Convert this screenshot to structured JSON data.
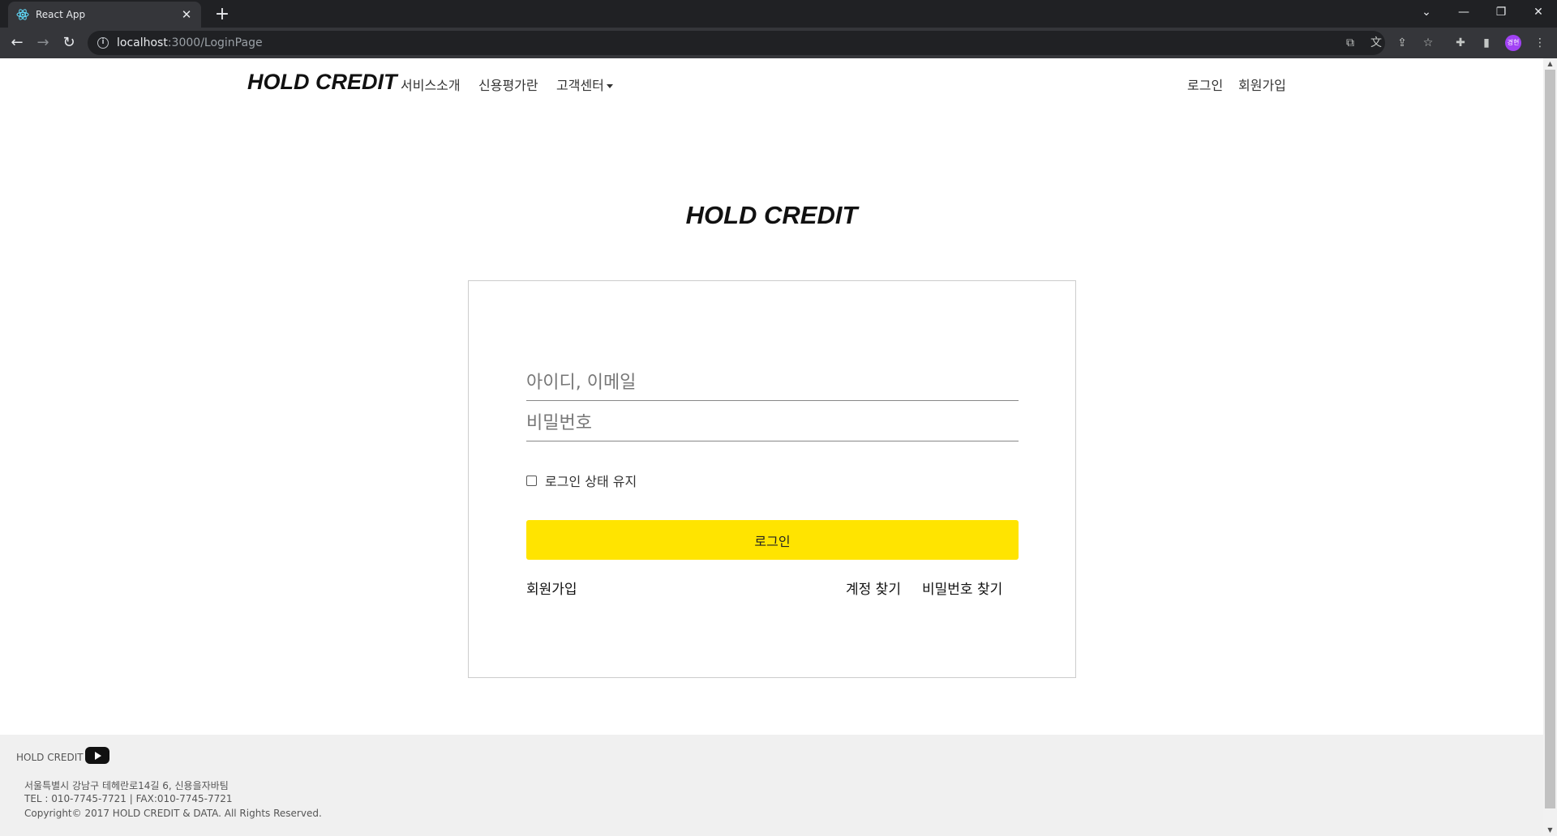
{
  "browser": {
    "tab_title": "React App",
    "url_host": "localhost",
    "url_path": ":3000/LoginPage",
    "profile_initials": "경현"
  },
  "nav": {
    "brand": "HOLD CREDIT",
    "links": [
      "서비스소개",
      "신용평가란",
      "고객센터"
    ],
    "login": "로그인",
    "signup": "회원가입"
  },
  "hero": {
    "title": "HOLD CREDIT"
  },
  "login_form": {
    "id_placeholder": "아이디, 이메일",
    "pw_placeholder": "비밀번호",
    "keep_logged_in": "로그인 상태 유지",
    "keep_checked": false,
    "submit": "로그인",
    "signup_link": "회원가입",
    "find_account": "계정 찾기",
    "find_password": "비밀번호 찾기",
    "accent_color": "#ffe400"
  },
  "footer": {
    "brand": "HOLD CREDIT",
    "address": "서울특별시 강남구 테헤란로14길 6, 신용을자바팀",
    "contact": "TEL : 010-7745-7721 | FAX:010-7745-7721",
    "copyright": "Copyright© 2017 HOLD CREDIT & DATA. All Rights Reserved."
  }
}
